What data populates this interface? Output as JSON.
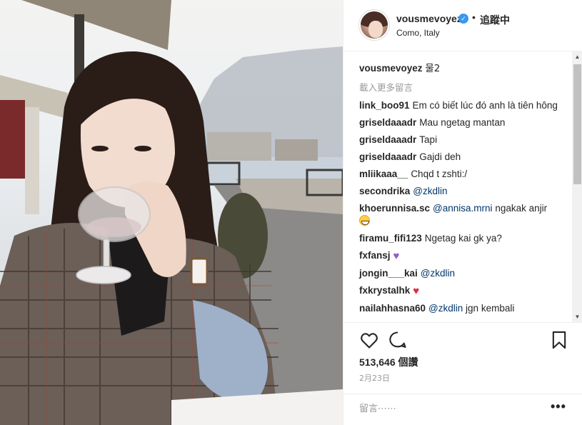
{
  "post": {
    "username": "vousmevoyez",
    "verified": true,
    "separator": "•",
    "follow_label": "追蹤中",
    "location": "Como, Italy",
    "caption_user": "vousmevoyez",
    "caption_text": "물2",
    "load_more": "載入更多留言",
    "comments": [
      {
        "user": "link_boo91",
        "text": "Em có biết lúc đó anh là tiên hông"
      },
      {
        "user": "griseldaaadr",
        "text": "Mau ngetag mantan"
      },
      {
        "user": "griseldaaadr",
        "text": "Tapi"
      },
      {
        "user": "griseldaaadr",
        "text": "Gajdi deh"
      },
      {
        "user": "mliikaaa__",
        "text": "Chqd t zshti:/"
      },
      {
        "user": "secondrika",
        "mention": "@zkdlin",
        "text": ""
      },
      {
        "user": "khoerunnisa.sc",
        "mention": "@annisa.mrni",
        "text": "ngakak anjir",
        "emoji": "grinning-squinting-face"
      },
      {
        "user": "firamu_fifi123",
        "text": "Ngetag kai gk ya?"
      },
      {
        "user": "fxfansj",
        "text": "",
        "emoji": "purple-heart"
      },
      {
        "user": "jongin___kai",
        "mention": "@zkdlin",
        "text": ""
      },
      {
        "user": "fxkrystalhk",
        "text": "",
        "emoji": "red-heart"
      },
      {
        "user": "nailahhasna60",
        "mention": "@zkdlin",
        "text": "jgn kembali"
      }
    ],
    "views_count": "513,646",
    "views_unit": "個讚",
    "date": "2月23日",
    "comment_placeholder": "留言⋯⋯",
    "more_label": "•••"
  },
  "icons": {
    "like": "heart-outline-icon",
    "comment": "speech-bubble-icon",
    "save": "bookmark-icon",
    "verified": "verified-badge-icon"
  },
  "colors": {
    "text": "#262626",
    "muted": "#999999",
    "mention": "#003569",
    "verified": "#3897f0",
    "border": "#efefef"
  }
}
